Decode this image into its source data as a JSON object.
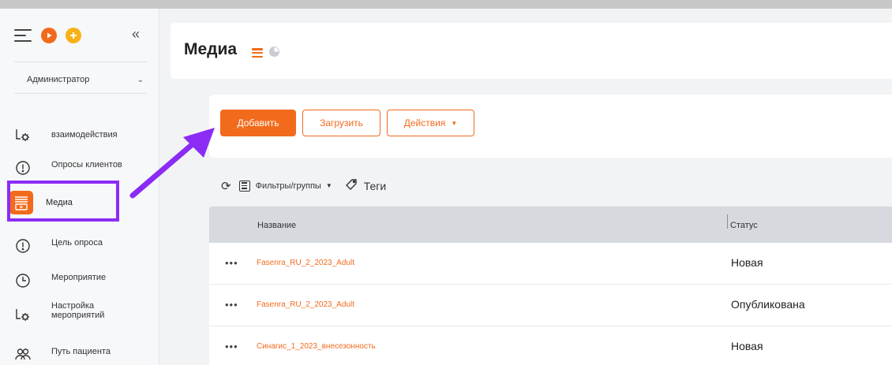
{
  "sidebar": {
    "role": "Администратор",
    "items": [
      {
        "label": "взаимодействия",
        "icon": "gear-bracket-icon"
      },
      {
        "label": "Опросы клиентов",
        "icon": "alert-bubble-icon"
      },
      {
        "label": "Медиа",
        "icon": "media-icon",
        "active": true
      },
      {
        "label": "Цель опроса",
        "icon": "alert-bubble-icon"
      },
      {
        "label": "Мероприятие",
        "icon": "clock-icon"
      },
      {
        "label": "Настройка\nмероприятий",
        "icon": "gear-bracket-icon"
      },
      {
        "label": "Путь пациента",
        "icon": "users-icon"
      }
    ]
  },
  "header": {
    "title": "Медиа"
  },
  "toolbar": {
    "add_label": "Добавить",
    "upload_label": "Загрузить",
    "actions_label": "Действия"
  },
  "filters": {
    "filters_label": "Фильтры/группы",
    "tags_label": "Теги"
  },
  "table": {
    "columns": {
      "name": "Название",
      "status": "Статус"
    },
    "rows": [
      {
        "name": "Fasenra_RU_2_2023_Adult",
        "status": "Новая"
      },
      {
        "name": "Fasenra_RU_2_2023_Adult",
        "status": "Опубликована"
      },
      {
        "name": "Синагис_1_2023_внесезонность",
        "status": "Новая"
      }
    ]
  },
  "colors": {
    "accent": "#f26b1d",
    "highlight": "#8b2cf5",
    "secondary": "#f7b21a"
  }
}
